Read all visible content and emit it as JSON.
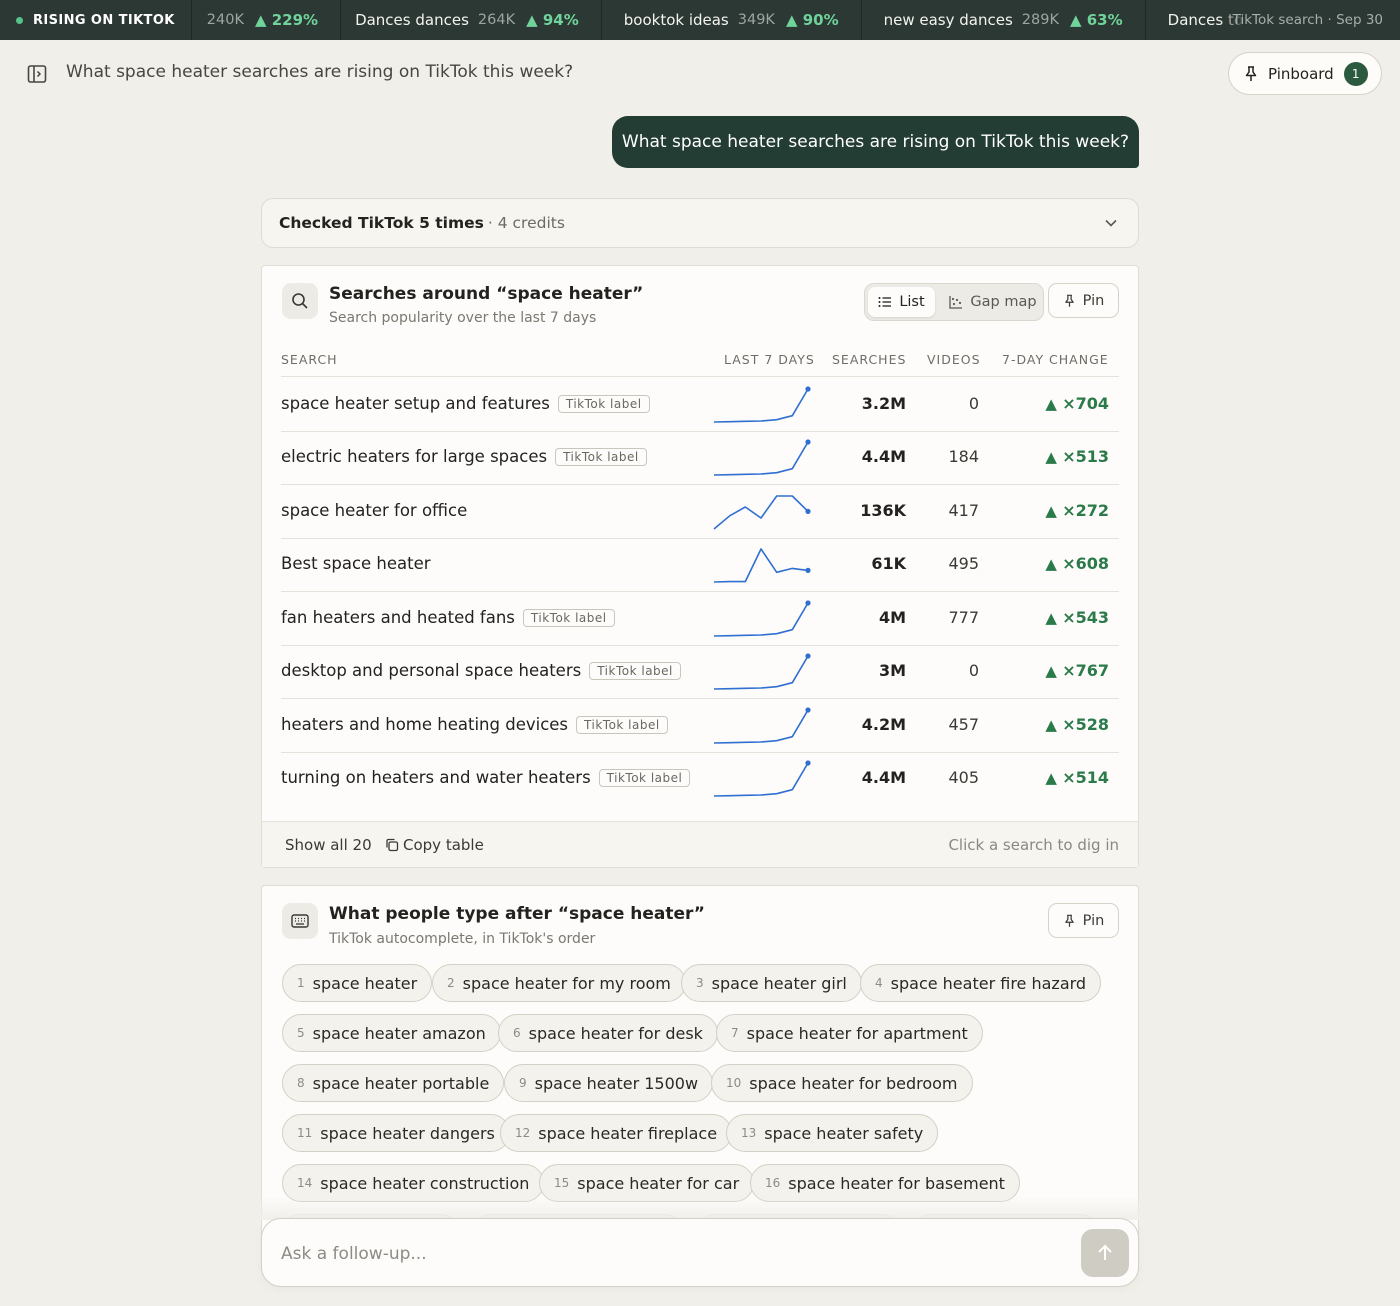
{
  "ticker": {
    "label": "RISING ON TIKTOK",
    "items": [
      {
        "term": "",
        "volume": "240K",
        "change": "229%"
      },
      {
        "term": "Dances dances",
        "volume": "264K",
        "change": "94%"
      },
      {
        "term": "booktok ideas",
        "volume": "349K",
        "change": "90%"
      },
      {
        "term": "new easy dances",
        "volume": "289K",
        "change": "63%"
      },
      {
        "term": "Dances to",
        "volume": "",
        "change": ""
      }
    ],
    "source": "TikTok search · Sep 30"
  },
  "header": {
    "title": "What space heater searches are rising on TikTok this week?",
    "pinboard_label": "Pinboard",
    "pinboard_count": "1"
  },
  "conversation": {
    "user_message": "What space heater searches are rising on TikTok this week?",
    "checked": {
      "label": "Checked TikTok 5 times",
      "credits": "· 4 credits"
    }
  },
  "searches_card": {
    "title": "Searches around “space heater”",
    "subtitle": "Search popularity over the last 7 days",
    "view_list": "List",
    "view_gap": "Gap map",
    "pin_label": "Pin",
    "columns": {
      "search": "SEARCH",
      "last7": "LAST 7 DAYS",
      "searches": "SEARCHES",
      "videos": "VIDEOS",
      "change": "7-DAY CHANGE"
    },
    "rows": [
      {
        "term": "space heater setup and features",
        "label": "TikTok label",
        "trend": [
          1,
          2,
          3,
          4,
          8,
          20,
          100
        ],
        "searches": "3.2M",
        "videos": "0",
        "change": "×704"
      },
      {
        "term": "electric heaters for large spaces",
        "label": "TikTok label",
        "trend": [
          1,
          2,
          3,
          4,
          8,
          20,
          100
        ],
        "searches": "4.4M",
        "videos": "184",
        "change": "×513"
      },
      {
        "term": "space heater for office",
        "label": "",
        "trend": [
          20,
          50,
          70,
          45,
          95,
          95,
          60
        ],
        "searches": "136K",
        "videos": "417",
        "change": "×272"
      },
      {
        "term": "Best space heater",
        "label": "",
        "trend": [
          5,
          6,
          6,
          90,
          30,
          40,
          35
        ],
        "searches": "61K",
        "videos": "495",
        "change": "×608"
      },
      {
        "term": "fan heaters and heated fans",
        "label": "TikTok label",
        "trend": [
          1,
          2,
          3,
          4,
          8,
          20,
          100
        ],
        "searches": "4M",
        "videos": "777",
        "change": "×543"
      },
      {
        "term": "desktop and personal space heaters",
        "label": "TikTok label",
        "trend": [
          1,
          2,
          3,
          4,
          8,
          20,
          100
        ],
        "searches": "3M",
        "videos": "0",
        "change": "×767"
      },
      {
        "term": "heaters and home heating devices",
        "label": "TikTok label",
        "trend": [
          1,
          2,
          3,
          4,
          8,
          20,
          100
        ],
        "searches": "4.2M",
        "videos": "457",
        "change": "×528"
      },
      {
        "term": "turning on heaters and water heaters",
        "label": "TikTok label",
        "trend": [
          1,
          2,
          3,
          4,
          8,
          20,
          100
        ],
        "searches": "4.4M",
        "videos": "405",
        "change": "×514"
      }
    ],
    "show_all": "Show all 20",
    "copy_table": "Copy table",
    "hint": "Click a search to dig in"
  },
  "autocomplete_card": {
    "title": "What people type after “space heater”",
    "subtitle": "TikTok autocomplete, in TikTok's order",
    "pin_label": "Pin",
    "suggestions": [
      {
        "n": "1",
        "text": "space heater"
      },
      {
        "n": "2",
        "text": "space heater for my room"
      },
      {
        "n": "3",
        "text": "space heater girl"
      },
      {
        "n": "4",
        "text": "space heater fire hazard"
      },
      {
        "n": "5",
        "text": "space heater amazon"
      },
      {
        "n": "6",
        "text": "space heater for desk"
      },
      {
        "n": "7",
        "text": "space heater for apartment"
      },
      {
        "n": "8",
        "text": "space heater portable"
      },
      {
        "n": "9",
        "text": "space heater 1500w"
      },
      {
        "n": "10",
        "text": "space heater for bedroom"
      },
      {
        "n": "11",
        "text": "space heater dangers"
      },
      {
        "n": "12",
        "text": "space heater fireplace"
      },
      {
        "n": "13",
        "text": "space heater safety"
      },
      {
        "n": "14",
        "text": "space heater construction"
      },
      {
        "n": "15",
        "text": "space heater for car"
      },
      {
        "n": "16",
        "text": "space heater for basement"
      }
    ]
  },
  "composer": {
    "placeholder": "Ask a follow-up..."
  },
  "colors": {
    "accent_dark": "#233c34",
    "positive": "#2b7a4a",
    "sparkline": "#2f6fd1",
    "ticker_positive": "#6fd39b"
  }
}
